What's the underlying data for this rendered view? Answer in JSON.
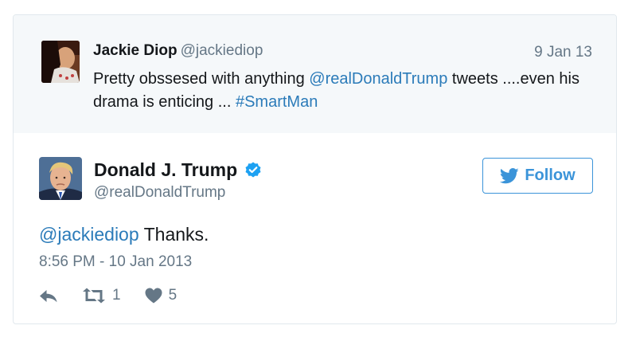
{
  "parent_tweet": {
    "name": "Jackie Diop",
    "handle": "@jackiediop",
    "date": "9 Jan 13",
    "text_parts": [
      "Pretty obssesed with anything ",
      "@realDonaldTrump",
      " tweets ....even his drama is enticing ... ",
      "#SmartMan"
    ]
  },
  "tweet": {
    "name": "Donald J. Trump",
    "handle": "@realDonaldTrump",
    "follow_label": "Follow",
    "text_parts": [
      "@jackiediop",
      " Thanks."
    ],
    "timestamp": "8:56 PM - 10 Jan 2013",
    "retweet_count": "1",
    "like_count": "5"
  },
  "icons": {
    "verified": "verified-badge-icon",
    "bird": "twitter-bird-icon",
    "reply": "reply-icon",
    "retweet": "retweet-icon",
    "like": "heart-icon"
  },
  "colors": {
    "link": "#2b7bb9",
    "follow": "#3b94d9",
    "muted": "#657786",
    "parent_bg": "#f5f8fa"
  }
}
